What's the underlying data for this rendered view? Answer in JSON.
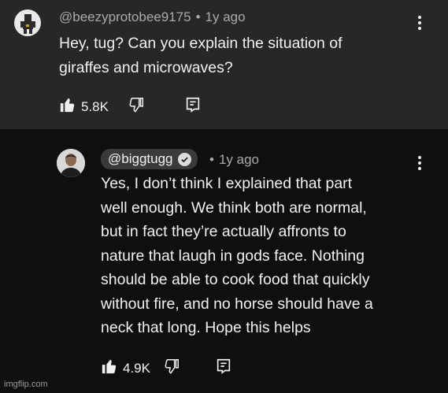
{
  "comment": {
    "username": "@beezyprotobee9175",
    "separator": "•",
    "time": "1y ago",
    "lines": [
      "Hey, tug? Can you explain the situation of",
      "giraffes and microwaves?"
    ],
    "likes": "5.8K",
    "icons": {
      "like": "thumbs-up-icon",
      "dislike": "thumbs-down-icon",
      "reply": "reply-icon",
      "more": "more-vert-icon"
    }
  },
  "reply": {
    "username": "@biggtugg",
    "separator": "•",
    "time": "1y ago",
    "lines": [
      "Yes, I don’t think I explained that part",
      "well enough. We think both are normal,",
      "but in fact they’re actually affronts to",
      "nature that laugh in gods face. Nothing",
      "should be able to cook food that quickly",
      "without fire, and no horse should have a",
      "neck that long. Hope this helps"
    ],
    "likes": "4.9K",
    "icons": {
      "like": "thumbs-up-icon",
      "dislike": "thumbs-down-icon",
      "reply": "reply-icon",
      "more": "more-vert-icon",
      "verified": "verified-check-icon"
    }
  },
  "watermark": "imgflip.com",
  "colors": {
    "comment_bg": "#272727",
    "reply_bg": "#0f0f0f",
    "text": "#f1f1f1",
    "meta": "#aaaaaa",
    "badge_bg": "#3a3a3a"
  }
}
